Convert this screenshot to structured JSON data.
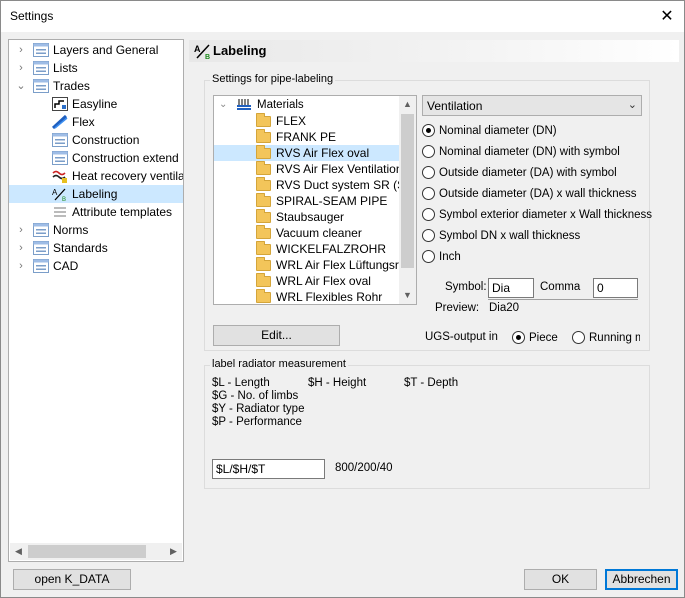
{
  "window": {
    "title": "Settings"
  },
  "tree": {
    "items": [
      {
        "label": "Layers and General",
        "icon": "settings-list-icon"
      },
      {
        "label": "Lists",
        "icon": "settings-list-icon"
      },
      {
        "label": "Trades",
        "icon": "settings-list-icon"
      },
      {
        "label": "Easyline",
        "icon": "easyline-icon"
      },
      {
        "label": "Flex",
        "icon": "flex-icon"
      },
      {
        "label": "Construction",
        "icon": "settings-list-icon"
      },
      {
        "label": "Construction extend",
        "icon": "settings-list-icon"
      },
      {
        "label": "Heat recovery ventila",
        "icon": "heat-recovery-icon"
      },
      {
        "label": "Labeling",
        "icon": "labeling-icon"
      },
      {
        "label": "Attribute templates",
        "icon": "attribute-template-icon"
      },
      {
        "label": "Norms",
        "icon": "settings-list-icon"
      },
      {
        "label": "Standards",
        "icon": "settings-list-icon"
      },
      {
        "label": "CAD",
        "icon": "settings-list-icon"
      }
    ]
  },
  "panel": {
    "title": "Labeling"
  },
  "pipe_labeling": {
    "group_label": "Settings for pipe-labeling",
    "materials_root": "Materials",
    "materials": [
      "FLEX",
      "FRANK PE",
      "RVS Air Flex oval",
      "RVS Air Flex Ventilation pip",
      "RVS Duct system SR (Spir",
      "SPIRAL-SEAM PIPE",
      "Staubsauger",
      "Vacuum cleaner",
      "WICKELFALZROHR",
      "WRL Air Flex Lüftungsrohr",
      "WRL Air Flex oval",
      "WRL Flexibles Rohr"
    ],
    "selected_material": "RVS Air Flex oval",
    "edit_button": "Edit...",
    "category_select": "Ventilation",
    "options": [
      "Nominal diameter (DN)",
      "Nominal diameter (DN) with symbol",
      "Outside diameter (DA) with symbol",
      "Outside diameter (DA) x wall thickness",
      "Symbol exterior diameter x Wall thickness",
      "Symbol DN x wall thickness",
      "Inch"
    ],
    "selected_option": "Nominal diameter (DN)",
    "symbol_label": "Symbol:",
    "symbol_value": "Dia",
    "comma_label": "Comma",
    "comma_value": "0",
    "preview_label": "Preview:",
    "preview_value": "Dia20",
    "ugs_label": "UGS-output in",
    "ugs_options": [
      "Piece",
      "Running m"
    ],
    "ugs_selected": "Piece"
  },
  "radiator": {
    "group_label": "label radiator measurement",
    "legend": {
      "length": "$L - Length",
      "height": "$H - Height",
      "depth": "$T - Depth",
      "limbs": "$G - No. of limbs",
      "type": "$Y - Radiator type",
      "performance": "$P - Performance"
    },
    "format_value": "$L/$H/$T",
    "format_preview": "800/200/40"
  },
  "footer": {
    "open_kdata": "open K_DATA",
    "ok": "OK",
    "cancel": "Abbrechen"
  },
  "colors": {
    "selection": "#cce8ff",
    "accent": "#0078d7",
    "folder": "#f3c55a"
  }
}
